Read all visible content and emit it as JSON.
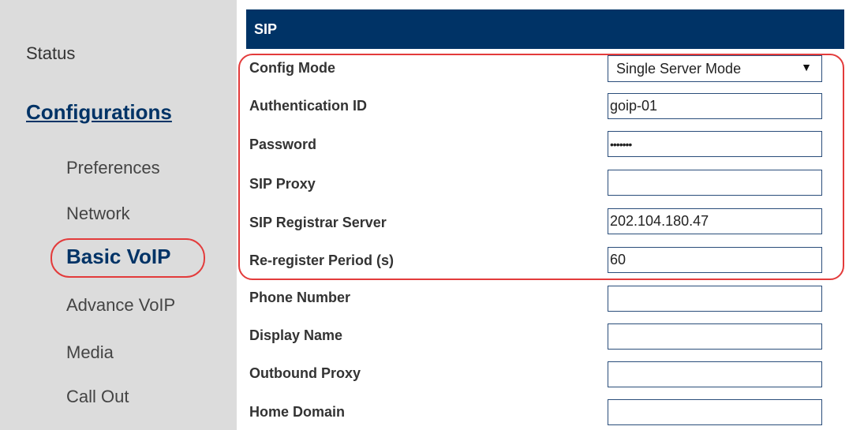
{
  "sidebar": {
    "status": "Status",
    "configurations": "Configurations",
    "items": [
      {
        "label": "Preferences"
      },
      {
        "label": "Network"
      },
      {
        "label": "Basic VoIP"
      },
      {
        "label": "Advance VoIP"
      },
      {
        "label": "Media"
      },
      {
        "label": "Call Out"
      }
    ]
  },
  "section": {
    "title": "SIP"
  },
  "form": {
    "config_mode": {
      "label": "Config Mode",
      "value": "Single Server Mode"
    },
    "auth_id": {
      "label": "Authentication ID",
      "value": "goip-01"
    },
    "password": {
      "label": "Password",
      "value": "•••••••"
    },
    "sip_proxy": {
      "label": "SIP Proxy",
      "value": ""
    },
    "registrar": {
      "label": "SIP Registrar Server",
      "value": "202.104.180.47"
    },
    "reregister": {
      "label": "Re-register Period (s)",
      "value": "60"
    },
    "phone_number": {
      "label": "Phone Number",
      "value": ""
    },
    "display_name": {
      "label": "Display Name",
      "value": ""
    },
    "outbound_proxy": {
      "label": "Outbound Proxy",
      "value": ""
    },
    "home_domain": {
      "label": "Home Domain",
      "value": ""
    }
  },
  "colors": {
    "header_bg": "#003366",
    "highlight": "#e33b3b",
    "sidebar_bg": "#dcdcdc"
  }
}
